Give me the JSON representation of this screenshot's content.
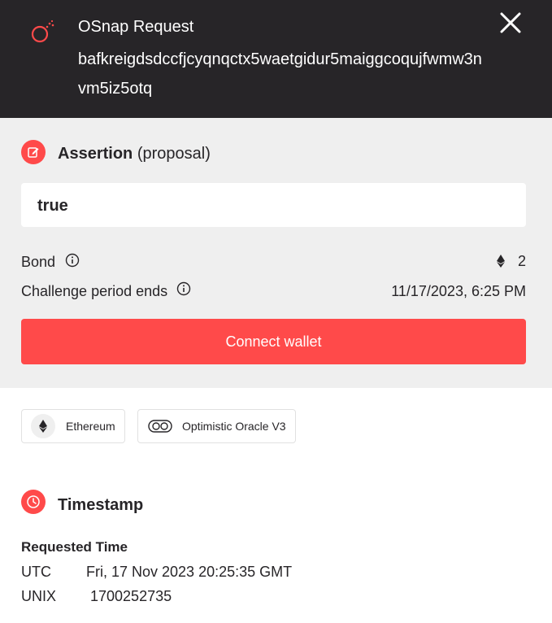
{
  "header": {
    "title": "OSnap Request",
    "request_id": "bafkreigdsdccfjcyqnqctx5waetgidur5maiggcoqujfwmw3nvm5iz5otq"
  },
  "assertion": {
    "title_bold": "Assertion",
    "title_suffix": "(proposal)",
    "value": "true",
    "bond_label": "Bond",
    "bond_value": "2",
    "challenge_label": "Challenge period ends",
    "challenge_value": "11/17/2023, 6:25 PM",
    "connect_label": "Connect wallet"
  },
  "chips": {
    "chain": "Ethereum",
    "oracle": "Optimistic Oracle V3"
  },
  "timestamp": {
    "title": "Timestamp",
    "requested_label": "Requested Time",
    "utc_label": "UTC",
    "utc_value": "Fri, 17 Nov 2023 20:25:35 GMT",
    "unix_label": "UNIX",
    "unix_value": "1700252735"
  },
  "colors": {
    "header_bg": "#272528",
    "accent": "#ff4a4a",
    "section_bg": "#efefef"
  }
}
